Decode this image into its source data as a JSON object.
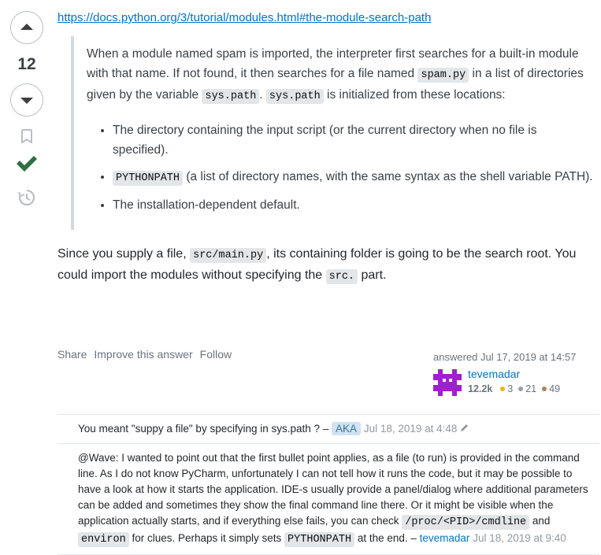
{
  "vote": {
    "count": "12"
  },
  "answer": {
    "link_text": "https://docs.python.org/3/tutorial/modules.html#the-module-search-path",
    "quote": {
      "p_part1": "When a module named spam is imported, the interpreter first searches for a built-in module with that name. If not found, it then searches for a file named ",
      "code1": "spam.py",
      "p_part2": " in a list of directories given by the variable ",
      "code2": "sys.path",
      "p_part3": ". ",
      "code3": "sys.path",
      "p_part4": " is initialized from these locations:",
      "bullet1": "The directory containing the input script (or the current directory when no file is specified).",
      "bullet2_code": "PYTHONPATH",
      "bullet2_text": " (a list of directory names, with the same syntax as the shell variable PATH).",
      "bullet3": "The installation-dependent default."
    },
    "para_part1": "Since you supply a file, ",
    "para_code1": "src/main.py",
    "para_part2": ", its containing folder is going to be the search root. You could import the modules without specifying the ",
    "para_code2": "src.",
    "para_part3": " part."
  },
  "menu": {
    "share": "Share",
    "improve": "Improve this answer",
    "follow": "Follow"
  },
  "signature": {
    "action": "answered Jul 17, 2019 at 14:57",
    "user": "tevemadar",
    "reputation": "12.2k",
    "gold": "3",
    "silver": "21",
    "bronze": "49"
  },
  "comments": [
    {
      "text": "You meant \"suppy a file\" by specifying in sys.path ? –",
      "user": "AKA",
      "date": "Jul 18, 2019 at 4:48"
    },
    {
      "text_part1": "@Wave: I wanted to point out that the first bullet point applies, as a file (to run) is provided in the command line. As I do not know PyCharm, unfortunately I can not tell how it runs the code, but it may be possible to have a look at how it starts the application. IDE-s usually provide a panel/dialog where additional parameters can be added and sometimes they show the final command line there. Or it might be visible when the application actually starts, and if everything else fails, you can check ",
      "code1": "/proc/<PID>/cmdline",
      "text_part2": " and ",
      "code2": "environ",
      "text_part3": " for clues. Perhaps it simply sets ",
      "code3": "PYTHONPATH",
      "text_part4": " at the end. –",
      "user": "tevemadar",
      "date": "Jul 18, 2019 at 9:40"
    }
  ],
  "colors": {
    "link": "#0074cc",
    "accepted": "#2f6f44",
    "gold": "#f1b600",
    "silver": "#9a9fa4",
    "bronze": "#ab825f"
  },
  "icons": [
    "upvote-arrow-icon",
    "downvote-arrow-icon",
    "bookmark-icon",
    "accepted-check-icon",
    "history-icon",
    "edit-pencil-icon"
  ]
}
